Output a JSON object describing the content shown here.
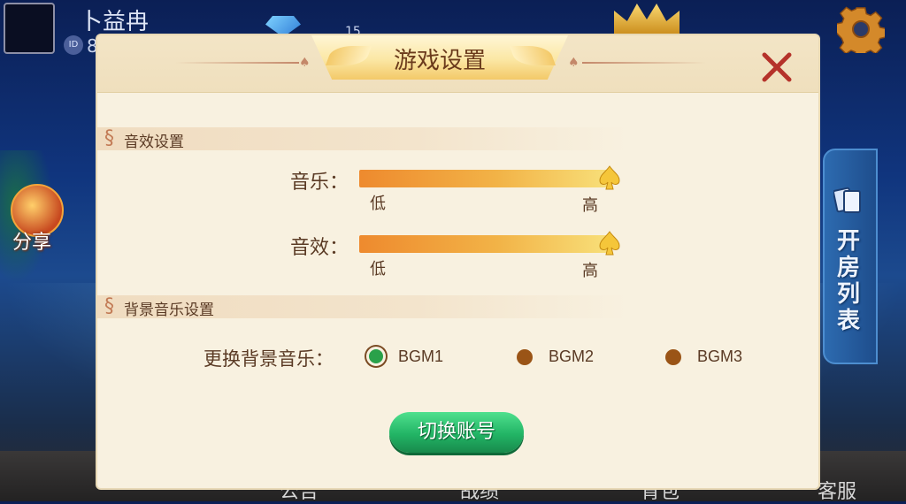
{
  "top_bar": {
    "username": "卜益冉",
    "id_badge": "ID",
    "id_number": "8",
    "currency_count": "15"
  },
  "side": {
    "share_label": "分享",
    "room_list_label": "开房列表"
  },
  "bottom_bar": {
    "items": [
      "公告",
      "战绩",
      "背包",
      "客服"
    ]
  },
  "dialog": {
    "title": "游戏设置",
    "sound_section": {
      "title": "音效设置",
      "music": {
        "label": "音乐：",
        "low": "低",
        "high": "高",
        "level": 1.0
      },
      "effects": {
        "label": "音效：",
        "low": "低",
        "high": "高",
        "level": 1.0
      }
    },
    "bgm_section": {
      "title": "背景音乐设置",
      "change_label": "更换背景音乐：",
      "options": [
        {
          "label": "BGM1",
          "selected": true
        },
        {
          "label": "BGM2",
          "selected": false
        },
        {
          "label": "BGM3",
          "selected": false
        }
      ]
    },
    "switch_account_label": "切换账号"
  },
  "colors": {
    "dialog_bg": "#f8f1e0",
    "accent_text": "#5a3a24",
    "close_red": "#b5322a",
    "selected_green": "#2aa14a",
    "button_green": "#22b465"
  }
}
